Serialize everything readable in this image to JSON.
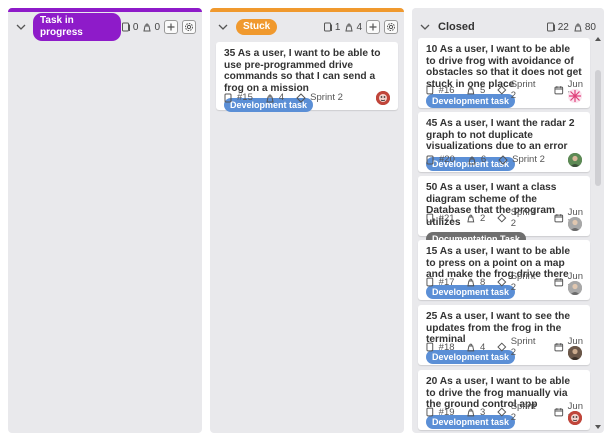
{
  "columns": [
    {
      "label": "Task in progress",
      "accent": "#8e1bc9",
      "stat_points": "0",
      "stat_users": "0"
    },
    {
      "label": "Stuck",
      "accent": "#f0992e",
      "stat_points": "1",
      "stat_users": "4"
    },
    {
      "label": "Closed",
      "accent": "#e9e9ec",
      "stat_points": "22",
      "stat_users": "80"
    }
  ],
  "stuck_cards": [
    {
      "title": "35 As a user, I want to be able to use pre-programmed drive commands so that I can send a frog on a mission",
      "tag": "Development task",
      "ref": "#15",
      "points": "4",
      "sprint": "Sprint 2",
      "date": ""
    }
  ],
  "closed_cards": [
    {
      "title": "10 As a user, I want to be able to drive frog with avoidance of obstacles so that it does not get stuck in one place",
      "tag": "Development task",
      "ref": "#16",
      "points": "5",
      "sprint": "Sprint 2",
      "date": "Jun 7"
    },
    {
      "title": "45 As a user, I want the radar 2 graph to not duplicate visualizations due to an error",
      "tag": "Development task",
      "ref": "#20",
      "points": "6",
      "sprint": "Sprint 2",
      "date": ""
    },
    {
      "title": "50 As a user, I want a class diagram scheme of the Database that the program utilizes",
      "tag": "Documentation Task",
      "ref": "#21",
      "points": "2",
      "sprint": "Sprint 2",
      "date": "Jun 7"
    },
    {
      "title": "15 As a user, I want to be able to press on a point on a map and make the frog drive there",
      "tag": "Development task",
      "ref": "#17",
      "points": "8",
      "sprint": "Sprint 2",
      "date": "Jun 3"
    },
    {
      "title": "25 As a user, I want to see the updates from the frog in the terminal",
      "tag": "Development task",
      "ref": "#18",
      "points": "4",
      "sprint": "Sprint 2",
      "date": "Jun 3"
    },
    {
      "title": "20 As a user, I want to be able to drive the frog manually via the ground control app",
      "tag": "Development task",
      "ref": "#19",
      "points": "3",
      "sprint": "Sprint 2",
      "date": "Jun 3"
    }
  ],
  "colors": {
    "dev_tag": "#5b8fd6",
    "doc_tag": "#6f6f6f",
    "column_bg": "#e9e9ec"
  }
}
